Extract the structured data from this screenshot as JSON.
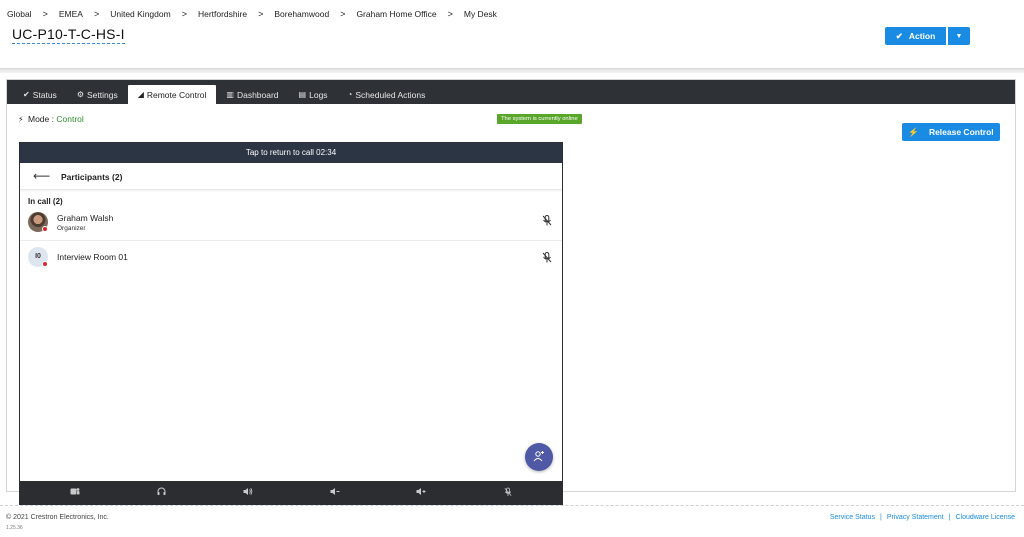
{
  "breadcrumb": {
    "items": [
      "Global",
      "EMEA",
      "United Kingdom",
      "Hertfordshire",
      "Borehamwood",
      "Graham Home Office",
      "My Desk"
    ],
    "separator": ">"
  },
  "page_title": "UC-P10-T-C-HS-I",
  "action": {
    "label": "Action",
    "check_icon": "✔",
    "caret_icon": "▼"
  },
  "tabs": [
    {
      "label": "Status",
      "icon": "✔",
      "active": false
    },
    {
      "label": "Settings",
      "icon": "⚙",
      "active": false
    },
    {
      "label": "Remote Control",
      "icon": "◢",
      "active": true
    },
    {
      "label": "Dashboard",
      "icon": "▥",
      "active": false
    },
    {
      "label": "Logs",
      "icon": "▤",
      "active": false
    },
    {
      "label": "Scheduled Actions",
      "icon": "◔",
      "active": false
    }
  ],
  "mode": {
    "label": "Mode :",
    "value": "Control"
  },
  "online_badge": "The system is currently online",
  "release_control": {
    "label": "Release Control",
    "icon": "⚡"
  },
  "device": {
    "call_banner": "Tap to return to call 02:34",
    "participants_title": "Participants (2)",
    "in_call_label": "In call (2)",
    "participants": [
      {
        "name": "Graham Walsh",
        "role": "Organizer",
        "initials": ""
      },
      {
        "name": "Interview Room 01",
        "role": "",
        "initials": "I0"
      }
    ],
    "bottom_bar_icons": [
      "teams-icon",
      "headset-icon",
      "volume-icon",
      "volume-down-icon",
      "volume-up-icon",
      "mic-off-icon"
    ]
  },
  "footer": {
    "copyright": "© 2021 Crestron Electronics, Inc.",
    "version": "1.25.36",
    "links": [
      "Service Status",
      "Privacy Statement",
      "Cloudware License"
    ],
    "link_separator": "|"
  },
  "colors": {
    "primary": "#1a8be2",
    "tabbar": "#2e3136",
    "online": "#5aa62a",
    "control_mode": "#2e8b2e",
    "call_banner": "#2b3544",
    "fab": "#5059a5",
    "status_dot": "#d9262c"
  }
}
